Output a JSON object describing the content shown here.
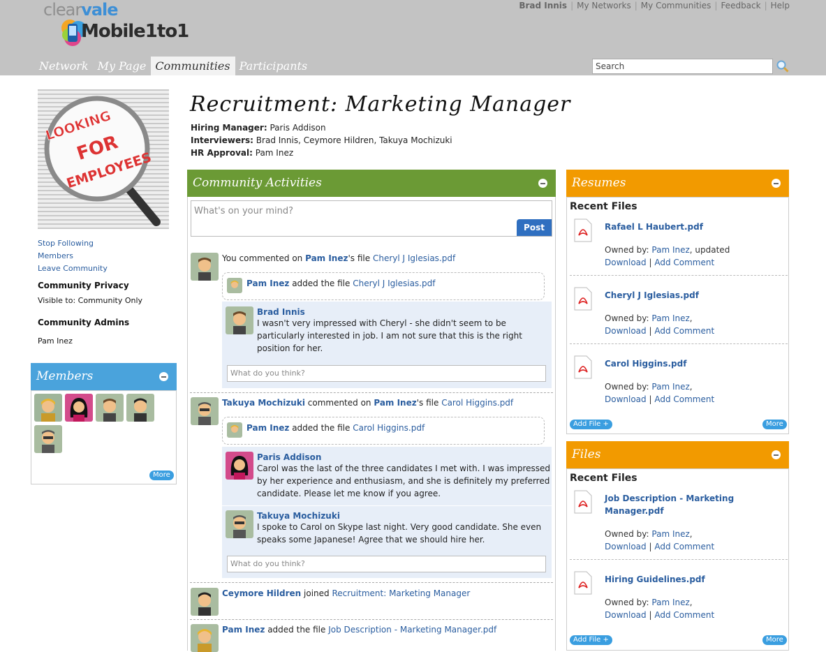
{
  "brand": {
    "logo_top_a": "clear",
    "logo_top_b": "vale",
    "logo_main": "Mobile1to1"
  },
  "header": {
    "user": "Brad Innis",
    "links": [
      "My Networks",
      "My Communities",
      "Feedback",
      "Help"
    ],
    "tabs": [
      "Network",
      "My Page",
      "Communities",
      "Participants"
    ],
    "active_tab": "Communities",
    "search_value": "Search"
  },
  "sidebar": {
    "hero_text": [
      "LOOKING",
      "FOR",
      "EMPLOYEES"
    ],
    "links": [
      "Stop Following",
      "Members",
      "Leave Community"
    ],
    "privacy_heading": "Community Privacy",
    "privacy_text": "Visible to: Community Only",
    "admins_heading": "Community Admins",
    "admin_name": "Pam Inez",
    "members_title": "Members",
    "more": "More"
  },
  "page": {
    "title": "Recruitment: Marketing Manager",
    "hiring_label": "Hiring Manager:",
    "hiring_value": "Paris Addison",
    "interviewers_label": "Interviewers:",
    "interviewers_value": "Brad Innis, Ceymore Hildren, Takuya Mochizuki",
    "hr_label": "HR Approval:",
    "hr_value": "Pam Inez"
  },
  "activities": {
    "title": "Community Activities",
    "placeholder": "What's on your mind?",
    "post": "Post",
    "think_placeholder": "What do you think?",
    "item1": {
      "actor": "You",
      "verb": " commented on ",
      "owner": "Pam Inez",
      "poss": "'s file ",
      "file": "Cheryl J Iglesias.pdf",
      "sub_actor": "Pam Inez",
      "sub_verb": " added the file ",
      "sub_file": "Cheryl J Iglesias.pdf",
      "c_name": "Brad Innis",
      "c_lines": [
        "I wasn't very impressed with Cheryl - she didn't seem to be",
        "particularly interested in job. I am not sure that this is the right",
        "position for her."
      ]
    },
    "item2": {
      "actor": "Takuya Mochizuki",
      "verb": " commented on ",
      "owner": "Pam Inez",
      "poss": "'s file ",
      "file": "Carol Higgins.pdf",
      "sub_actor": "Pam Inez",
      "sub_verb": " added the file ",
      "sub_file": "Carol Higgins.pdf",
      "c1_name": "Paris Addison",
      "c1_lines": [
        "Carol was the last of the three candidates I met with. I was impressed",
        "by her experience and enthusiasm, and she is definitely my preferred",
        "candidate. Please let me know if you agree."
      ],
      "c2_name": "Takuya Mochizuki",
      "c2_lines": [
        "I spoke to Carol on Skype last night. Very good candidate. She even",
        "speaks some Japanese! Agree that we should hire her."
      ]
    },
    "item3": {
      "actor": "Ceymore Hildren",
      "verb": " joined ",
      "target": "Recruitment: Marketing Manager"
    },
    "item4": {
      "actor": "Pam Inez",
      "verb": " added the file ",
      "file": "Job Description - Marketing Manager.pdf"
    }
  },
  "resumes": {
    "title": "Resumes",
    "recent": "Recent Files",
    "files": [
      {
        "name": "Rafael L Haubert.pdf",
        "owned": "Owned by: ",
        "owner": "Pam Inez",
        "suffix": ", updated"
      },
      {
        "name": "Cheryl J Iglesias.pdf",
        "owned": "Owned by: ",
        "owner": "Pam Inez",
        "suffix": ","
      },
      {
        "name": "Carol Higgins.pdf",
        "owned": "Owned by: ",
        "owner": "Pam Inez",
        "suffix": ","
      }
    ],
    "download": "Download",
    "sep": " | ",
    "add_comment": "Add Comment",
    "add_file": "Add File +",
    "more": "More"
  },
  "files": {
    "title": "Files",
    "recent": "Recent Files",
    "files": [
      {
        "name_l1": "Job Description - Marketing",
        "name_l2": "Manager.pdf",
        "owned": "Owned by: ",
        "owner": "Pam Inez",
        "suffix": ","
      },
      {
        "name_l1": "Hiring Guidelines.pdf",
        "name_l2": "",
        "owned": "Owned by: ",
        "owner": "Pam Inez",
        "suffix": ","
      }
    ],
    "download": "Download",
    "sep": " | ",
    "add_comment": "Add Comment",
    "add_file": "Add File +",
    "more": "More"
  },
  "colors": {
    "green": "#6b9a35",
    "blue": "#4aa3dc",
    "orange": "#f29a00",
    "link": "#2a5d9f"
  }
}
